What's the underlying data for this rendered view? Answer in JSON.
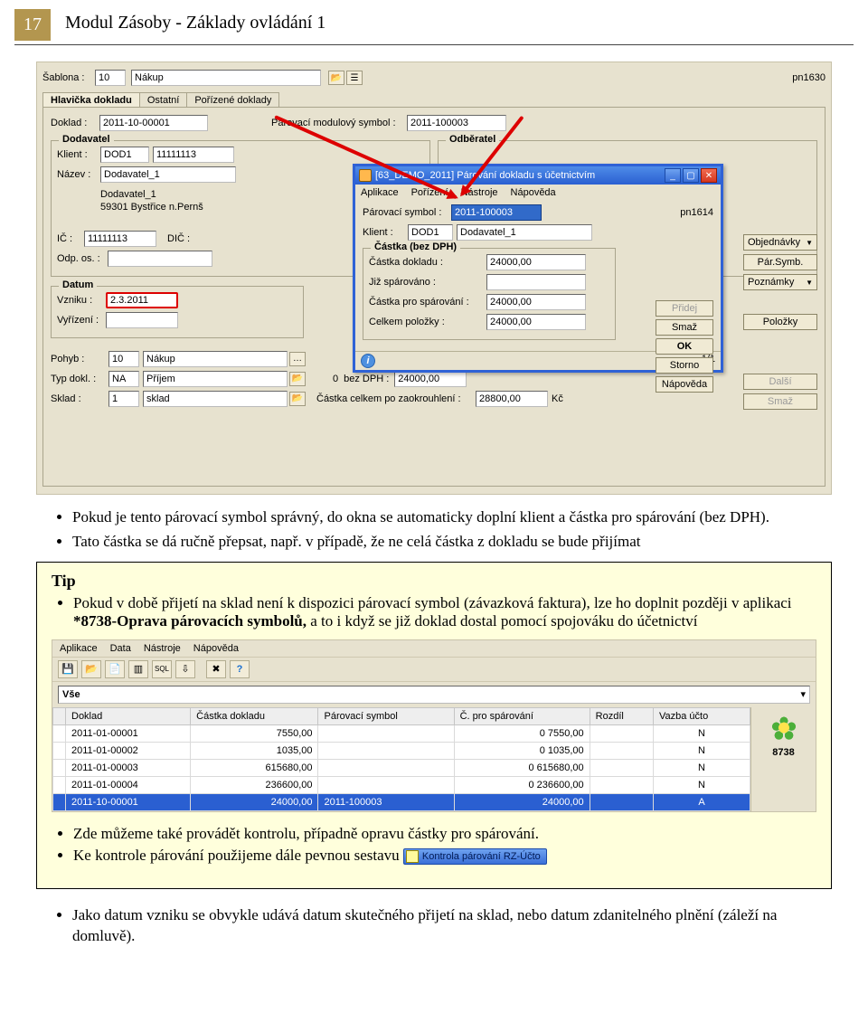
{
  "header": {
    "page_number": "17",
    "title": "Modul Zásoby - Základy ovládání 1"
  },
  "app1": {
    "sablona_label": "Šablona :",
    "sablona_code": "10",
    "sablona_name": "Nákup",
    "right_code": "pn1630",
    "tabs": [
      "Hlavička dokladu",
      "Ostatní",
      "Pořízené doklady"
    ],
    "doklad_label": "Doklad :",
    "doklad_val": "2011-10-00001",
    "parsym_label": "Párovací modulový symbol :",
    "parsym_val": "2011-100003",
    "dodavatel_legend": "Dodavatel",
    "odberatel_legend": "Odběratel",
    "klient_label": "Klient :",
    "klient_code": "DOD1",
    "klient_num": "11111113",
    "nazev_label": "Název :",
    "nazev_val": "Dodavatel_1",
    "adr_line1": "Dodavatel_1",
    "adr_line2": "59301  Bystřice n.Pernš",
    "ic_label": "IČ :",
    "ic_val": "11111113",
    "dic_label": "DIČ :",
    "odp_label": "Odp. os. :",
    "datum_legend": "Datum",
    "vzniku_label": "Vzniku :",
    "vzniku_val": "2.3.2011",
    "vyrizeni_label": "Vyřízení :",
    "pohyb_label": "Pohyb :",
    "pohyb_code": "10",
    "pohyb_name": "Nákup",
    "typdokl_label": "Typ dokl. :",
    "typdokl_code": "NA",
    "typdokl_name": "Příjem",
    "sklad_label": "Sklad :",
    "sklad_code": "1",
    "sklad_name": "sklad",
    "bezdph": "bez DPH :",
    "bezdph_val": "24000,00",
    "zaokr_label": "Částka celkem po zaokrouhlení :",
    "zaokr_val": "28800,00",
    "zaokr_cur": "Kč",
    "sidebtns": {
      "objednavky": "Objednávky",
      "parsymb": "Pár.Symb.",
      "poznamky": "Poznámky",
      "polozky": "Položky",
      "dalsi": "Další",
      "smaz2": "Smaž"
    }
  },
  "dlg": {
    "title": "[63_DEMO_2011] Párování dokladu s účetnictvím",
    "menu": [
      "Aplikace",
      "Pořízení",
      "Nástroje",
      "Nápověda"
    ],
    "parsym_label": "Párovací symbol :",
    "parsym_val": "2011-100003",
    "right_code": "pn1614",
    "klient_label": "Klient :",
    "klient_code": "DOD1",
    "klient_name": "Dodavatel_1",
    "group_legend": "Částka (bez DPH)",
    "r1l": "Částka dokladu :",
    "r1v": "24000,00",
    "r2l": "Již spárováno :",
    "r3l": "Částka pro spárování :",
    "r3v": "24000,00",
    "r4l": "Celkem položky :",
    "r4v": "24000,00",
    "btns": {
      "pridej": "Přidej",
      "smaz": "Smaž",
      "ok": "OK",
      "storno": "Storno",
      "napoveda": "Nápověda"
    },
    "status_right": "1/1"
  },
  "bullets_top": [
    "Pokud je tento párovací symbol správný, do okna se automaticky doplní klient a částka pro spárování (bez DPH).",
    "Tato částka se dá ručně přepsat, např. v případě, že ne celá částka z dokladu se bude přijímat"
  ],
  "tip": {
    "head": "Tip",
    "bullet1_a": "Pokud v době přijetí na sklad není k dispozici párovací symbol (závazková faktura), lze ho doplnit později v aplikaci ",
    "bullet1_b": "*8738-Oprava párovacích symbolů, ",
    "bullet1_c": "a to i když se již doklad dostal pomocí spojováku do  účetnictví"
  },
  "app2": {
    "menu": [
      "Aplikace",
      "Data",
      "Nástroje",
      "Nápověda"
    ],
    "filter": "Vše",
    "cols": [
      "Doklad",
      "Částka dokladu",
      "Párovací symbol",
      "Č. pro spárování",
      "Rozdíl",
      "Vazba účto"
    ],
    "rows": [
      {
        "d": "2011-01-00001",
        "c": "7550,00",
        "p": "",
        "cs": "0 7550,00",
        "r": "",
        "v": "N"
      },
      {
        "d": "2011-01-00002",
        "c": "1035,00",
        "p": "",
        "cs": "0 1035,00",
        "r": "",
        "v": "N"
      },
      {
        "d": "2011-01-00003",
        "c": "615680,00",
        "p": "",
        "cs": "0 615680,00",
        "r": "",
        "v": "N"
      },
      {
        "d": "2011-01-00004",
        "c": "236600,00",
        "p": "",
        "cs": "0 236600,00",
        "r": "",
        "v": "N"
      },
      {
        "d": "2011-10-00001",
        "c": "24000,00",
        "p": "2011-100003",
        "cs": "24000,00",
        "r": "",
        "v": "A"
      }
    ],
    "side_num": "8738"
  },
  "bullets_tip2": [
    "Zde můžeme také provádět kontrolu, případně opravu částky pro spárování.",
    "Ke kontrole párování použijeme dále pevnou sestavu"
  ],
  "pill_label": "Kontrola párování RZ-Účto",
  "bullet_bottom": "Jako datum vzniku se obvykle udává datum skutečného přijetí na sklad, nebo datum zdanitelného plnění (záleží na domluvě)."
}
